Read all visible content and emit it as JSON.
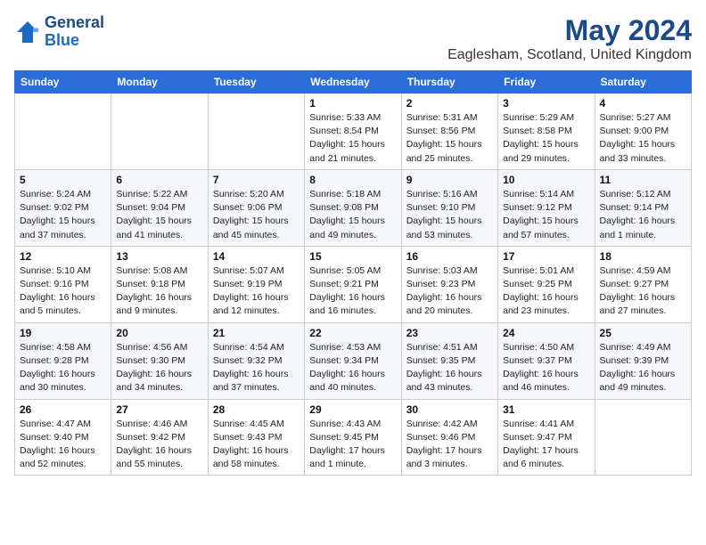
{
  "header": {
    "logo_line1": "General",
    "logo_line2": "Blue",
    "title": "May 2024",
    "subtitle": "Eaglesham, Scotland, United Kingdom"
  },
  "weekdays": [
    "Sunday",
    "Monday",
    "Tuesday",
    "Wednesday",
    "Thursday",
    "Friday",
    "Saturday"
  ],
  "weeks": [
    [
      null,
      null,
      null,
      {
        "day": "1",
        "sunrise": "5:33 AM",
        "sunset": "8:54 PM",
        "daylight": "15 hours and 21 minutes."
      },
      {
        "day": "2",
        "sunrise": "5:31 AM",
        "sunset": "8:56 PM",
        "daylight": "15 hours and 25 minutes."
      },
      {
        "day": "3",
        "sunrise": "5:29 AM",
        "sunset": "8:58 PM",
        "daylight": "15 hours and 29 minutes."
      },
      {
        "day": "4",
        "sunrise": "5:27 AM",
        "sunset": "9:00 PM",
        "daylight": "15 hours and 33 minutes."
      }
    ],
    [
      {
        "day": "5",
        "sunrise": "5:24 AM",
        "sunset": "9:02 PM",
        "daylight": "15 hours and 37 minutes."
      },
      {
        "day": "6",
        "sunrise": "5:22 AM",
        "sunset": "9:04 PM",
        "daylight": "15 hours and 41 minutes."
      },
      {
        "day": "7",
        "sunrise": "5:20 AM",
        "sunset": "9:06 PM",
        "daylight": "15 hours and 45 minutes."
      },
      {
        "day": "8",
        "sunrise": "5:18 AM",
        "sunset": "9:08 PM",
        "daylight": "15 hours and 49 minutes."
      },
      {
        "day": "9",
        "sunrise": "5:16 AM",
        "sunset": "9:10 PM",
        "daylight": "15 hours and 53 minutes."
      },
      {
        "day": "10",
        "sunrise": "5:14 AM",
        "sunset": "9:12 PM",
        "daylight": "15 hours and 57 minutes."
      },
      {
        "day": "11",
        "sunrise": "5:12 AM",
        "sunset": "9:14 PM",
        "daylight": "16 hours and 1 minute."
      }
    ],
    [
      {
        "day": "12",
        "sunrise": "5:10 AM",
        "sunset": "9:16 PM",
        "daylight": "16 hours and 5 minutes."
      },
      {
        "day": "13",
        "sunrise": "5:08 AM",
        "sunset": "9:18 PM",
        "daylight": "16 hours and 9 minutes."
      },
      {
        "day": "14",
        "sunrise": "5:07 AM",
        "sunset": "9:19 PM",
        "daylight": "16 hours and 12 minutes."
      },
      {
        "day": "15",
        "sunrise": "5:05 AM",
        "sunset": "9:21 PM",
        "daylight": "16 hours and 16 minutes."
      },
      {
        "day": "16",
        "sunrise": "5:03 AM",
        "sunset": "9:23 PM",
        "daylight": "16 hours and 20 minutes."
      },
      {
        "day": "17",
        "sunrise": "5:01 AM",
        "sunset": "9:25 PM",
        "daylight": "16 hours and 23 minutes."
      },
      {
        "day": "18",
        "sunrise": "4:59 AM",
        "sunset": "9:27 PM",
        "daylight": "16 hours and 27 minutes."
      }
    ],
    [
      {
        "day": "19",
        "sunrise": "4:58 AM",
        "sunset": "9:28 PM",
        "daylight": "16 hours and 30 minutes."
      },
      {
        "day": "20",
        "sunrise": "4:56 AM",
        "sunset": "9:30 PM",
        "daylight": "16 hours and 34 minutes."
      },
      {
        "day": "21",
        "sunrise": "4:54 AM",
        "sunset": "9:32 PM",
        "daylight": "16 hours and 37 minutes."
      },
      {
        "day": "22",
        "sunrise": "4:53 AM",
        "sunset": "9:34 PM",
        "daylight": "16 hours and 40 minutes."
      },
      {
        "day": "23",
        "sunrise": "4:51 AM",
        "sunset": "9:35 PM",
        "daylight": "16 hours and 43 minutes."
      },
      {
        "day": "24",
        "sunrise": "4:50 AM",
        "sunset": "9:37 PM",
        "daylight": "16 hours and 46 minutes."
      },
      {
        "day": "25",
        "sunrise": "4:49 AM",
        "sunset": "9:39 PM",
        "daylight": "16 hours and 49 minutes."
      }
    ],
    [
      {
        "day": "26",
        "sunrise": "4:47 AM",
        "sunset": "9:40 PM",
        "daylight": "16 hours and 52 minutes."
      },
      {
        "day": "27",
        "sunrise": "4:46 AM",
        "sunset": "9:42 PM",
        "daylight": "16 hours and 55 minutes."
      },
      {
        "day": "28",
        "sunrise": "4:45 AM",
        "sunset": "9:43 PM",
        "daylight": "16 hours and 58 minutes."
      },
      {
        "day": "29",
        "sunrise": "4:43 AM",
        "sunset": "9:45 PM",
        "daylight": "17 hours and 1 minute."
      },
      {
        "day": "30",
        "sunrise": "4:42 AM",
        "sunset": "9:46 PM",
        "daylight": "17 hours and 3 minutes."
      },
      {
        "day": "31",
        "sunrise": "4:41 AM",
        "sunset": "9:47 PM",
        "daylight": "17 hours and 6 minutes."
      },
      null
    ]
  ]
}
